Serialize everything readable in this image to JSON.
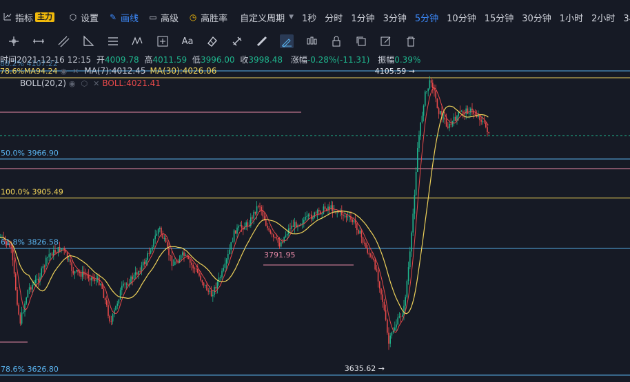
{
  "toolbar": {
    "indicator_label": "指标",
    "indicator_badge": "主力",
    "settings_label": "设置",
    "draw_label": "画线",
    "advanced_label": "高级",
    "winrate_label": "高胜率",
    "custom_period_label": "自定义周期",
    "periods": [
      "1秒",
      "分时",
      "1分钟",
      "3分钟",
      "5分钟",
      "10分钟",
      "15分钟",
      "30分钟",
      "1小时",
      "2小时",
      "3小"
    ],
    "active_period": "5分钟"
  },
  "ohlc": {
    "time_label": "时间",
    "time": "2021-12-16 12:15",
    "open_label": "开",
    "open": "4009.78",
    "high_label": "高",
    "high": "4011.59",
    "low_label": "低",
    "low": "3996.00",
    "close_label": "收",
    "close": "3998.48",
    "change_label": "涨幅",
    "change": "-0.28%(-11.31)",
    "amplitude_label": "振幅",
    "amplitude": "0.39%"
  },
  "indicators": {
    "ma_partial": "78.6%MA94.24",
    "ma7": "MA(7):4012.45",
    "ma30": "MA(30):4026.06",
    "boll_name": "BOLL(20,2)",
    "boll_value": "BOLL:4021.41",
    "hidden_fib": "88.2% 4107.22"
  },
  "fib_levels": [
    {
      "label": "50.0% 3966.90",
      "price": 3966.9,
      "color": "#5ab4f0"
    },
    {
      "label": "100.0% 3905.49",
      "price": 3905.49,
      "color": "#f0d35a"
    },
    {
      "label": "61.8% 3826.58",
      "price": 3826.58,
      "color": "#5ab4f0"
    },
    {
      "label": "78.6% 3626.80",
      "price": 3626.8,
      "color": "#5ab4f0"
    }
  ],
  "price_marks": {
    "high_label": "4105.59",
    "low_label": "3635.62",
    "mid_label": "3791.95"
  },
  "colors": {
    "background": "#161a25",
    "up": "#1fb58d",
    "down": "#e8494a",
    "ma7": "#e8494a",
    "ma30": "#f0d35a",
    "accent": "#3d8bfd",
    "gold": "#f0b90b"
  }
}
